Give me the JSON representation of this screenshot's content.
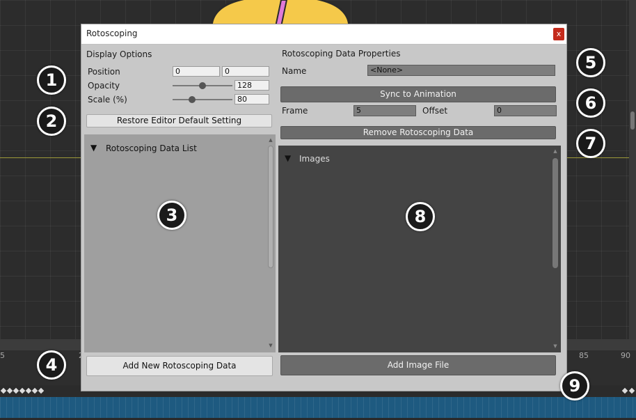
{
  "window": {
    "title": "Rotoscoping",
    "close_label": "x"
  },
  "display_options": {
    "header": "Display Options",
    "position_label": "Position",
    "position_x": "0",
    "position_y": "0",
    "opacity_label": "Opacity",
    "opacity_value": "128",
    "opacity_level": 0.5,
    "scale_label": "Scale (%)",
    "scale_value": "80",
    "scale_level": 0.3,
    "restore_button": "Restore Editor Default Setting"
  },
  "data_list": {
    "header": "Rotoscoping Data List",
    "add_button": "Add New Rotoscoping Data"
  },
  "properties": {
    "header": "Rotoscoping Data Properties",
    "name_label": "Name",
    "name_value": "<None>",
    "sync_button": "Sync to Animation",
    "frame_label": "Frame",
    "frame_value": "5",
    "offset_label": "Offset",
    "offset_value": "0",
    "remove_button": "Remove Rotoscoping Data"
  },
  "images": {
    "header": "Images",
    "add_button": "Add Image File"
  },
  "timeline": {
    "ticks": [
      "5",
      "2",
      "85",
      "90"
    ]
  },
  "badges": [
    "1",
    "2",
    "3",
    "4",
    "5",
    "6",
    "7",
    "8",
    "9"
  ],
  "icons": {
    "foldout": "triangle-down-icon",
    "close": "close-icon"
  },
  "colors": {
    "window_bg": "#c8c8c8",
    "close_red": "#c42b1c",
    "track_blue": "#1e5a80"
  }
}
